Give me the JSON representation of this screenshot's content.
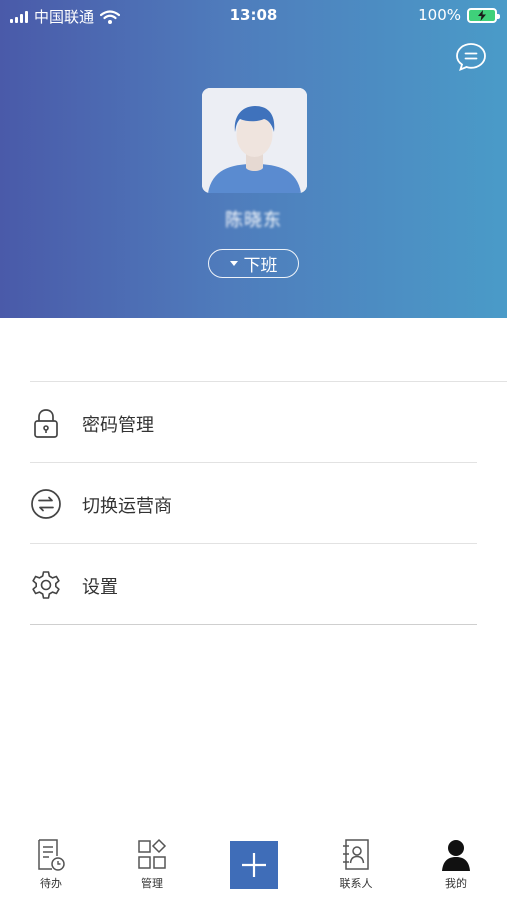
{
  "status_bar": {
    "carrier": "中国联通",
    "time": "13:08",
    "battery": "100%"
  },
  "profile": {
    "name": "陈晓东",
    "status": "下班"
  },
  "menu": [
    {
      "label": "密码管理",
      "icon": "lock-icon"
    },
    {
      "label": "切换运营商",
      "icon": "switch-icon"
    },
    {
      "label": "设置",
      "icon": "gear-icon"
    }
  ],
  "tabbar": {
    "items": [
      {
        "label": "待办",
        "icon": "todo-icon"
      },
      {
        "label": "管理",
        "icon": "manage-grid-icon"
      },
      {
        "label": "",
        "icon": "plus-icon"
      },
      {
        "label": "联系人",
        "icon": "contacts-icon"
      },
      {
        "label": "我的",
        "icon": "person-icon"
      }
    ],
    "active_index": 4
  },
  "colors": {
    "header_gradient_start": "#4a5aa9",
    "header_gradient_end": "#4a9bc8",
    "accent_button": "#3f6db8"
  }
}
